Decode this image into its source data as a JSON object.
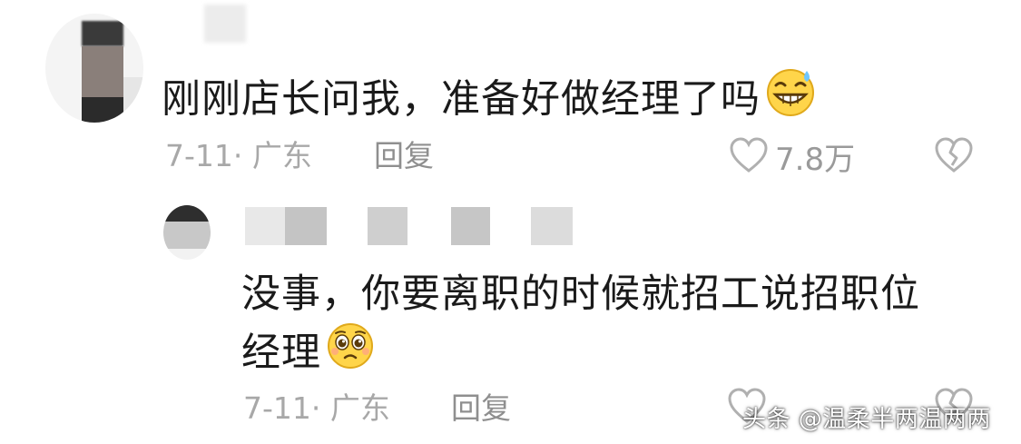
{
  "comments": [
    {
      "text": "刚刚店长问我，准备好做经理了吗",
      "emoji": "grinning-sweat-emoji",
      "date_location": "7-11· 广东",
      "reply_label": "回复",
      "likes": "7.8万"
    }
  ],
  "reply": {
    "text_line_1": "没事，你要离职的时候就招工说招职位",
    "text_line_2": "经理",
    "emoji": "pleading-face-emoji",
    "date_location": "7-11· 广东",
    "reply_label": "回复"
  },
  "icons": {
    "like": "heart-outline-icon",
    "dislike": "broken-heart-icon"
  },
  "watermark": "头条 @温柔半两温两两",
  "colors": {
    "text": "#1a1a1a",
    "meta": "#a8a8a8",
    "reply": "#8f8f8f",
    "icon": "#b0b0b0"
  }
}
